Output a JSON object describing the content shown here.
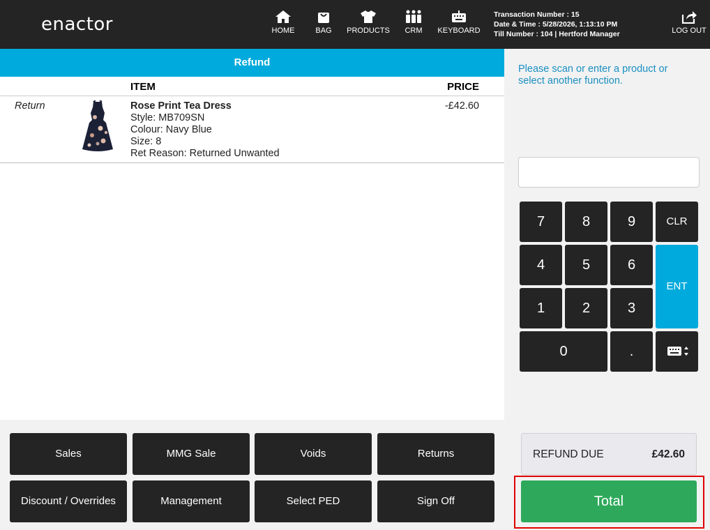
{
  "header": {
    "logo": "enactor",
    "nav": [
      {
        "label": "HOME",
        "icon": "home-icon"
      },
      {
        "label": "BAG",
        "icon": "bag-icon"
      },
      {
        "label": "PRODUCTS",
        "icon": "tshirt-icon"
      },
      {
        "label": "CRM",
        "icon": "people-icon"
      },
      {
        "label": "KEYBOARD",
        "icon": "keyboard-icon"
      }
    ],
    "transaction": {
      "number": "Transaction Number : 15",
      "datetime": "Date & Time : 5/28/2026, 1:13:10 PM",
      "till": "Till Number : 104  |  Hertford Manager"
    },
    "logout": {
      "label": "LOG OUT",
      "icon": "logout-icon"
    }
  },
  "mode_title": "Refund",
  "basket": {
    "columns": {
      "item": "ITEM",
      "price": "PRICE"
    },
    "rows": [
      {
        "type": "Return",
        "name": "Rose Print Tea Dress",
        "style": "Style: MB709SN",
        "colour": "Colour: Navy Blue",
        "size": "Size: 8",
        "reason": "Ret Reason: Returned Unwanted",
        "price": "-£42.60",
        "image_icon": "dress-thumbnail"
      }
    ]
  },
  "functions": [
    "Sales",
    "MMG Sale",
    "Voids",
    "Returns",
    "Discount / Overrides",
    "Management",
    "Select PED",
    "Sign Off"
  ],
  "prompt": "Please scan or enter a product or select another function.",
  "entry": {
    "value": "",
    "placeholder": ""
  },
  "keypad": {
    "k7": "7",
    "k8": "8",
    "k9": "9",
    "clr": "CLR",
    "k4": "4",
    "k5": "5",
    "k6": "6",
    "ent": "ENT",
    "k1": "1",
    "k2": "2",
    "k3": "3",
    "k0": "0",
    "dot": ".",
    "kbd_icon": "keyboard-toggle-icon"
  },
  "refund_due": {
    "label": "REFUND DUE",
    "value": "£42.60"
  },
  "total_label": "Total",
  "colors": {
    "accent": "#00aadc",
    "total": "#2ea95b",
    "dark": "#242424",
    "highlight": "#e00000"
  }
}
